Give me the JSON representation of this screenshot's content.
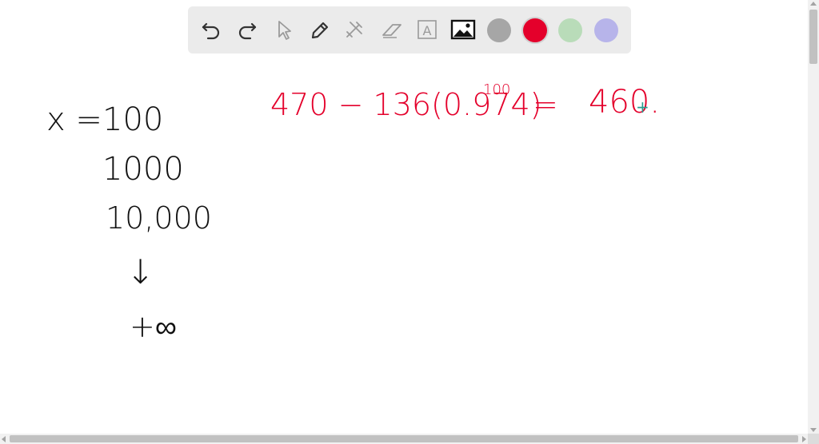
{
  "toolbar": {
    "tools": [
      {
        "name": "undo-icon"
      },
      {
        "name": "redo-icon"
      },
      {
        "name": "pointer-icon"
      },
      {
        "name": "pen-icon"
      },
      {
        "name": "tools-icon"
      },
      {
        "name": "eraser-icon"
      },
      {
        "name": "text-icon",
        "glyph": "A"
      },
      {
        "name": "image-icon"
      }
    ],
    "colors": [
      {
        "name": "gray",
        "hex": "#a6a6a6"
      },
      {
        "name": "red",
        "hex": "#e4002b"
      },
      {
        "name": "green",
        "hex": "#b9dcb9"
      },
      {
        "name": "purple",
        "hex": "#b7b4ea"
      }
    ],
    "selected_color": "red"
  },
  "board": {
    "x_label": "x =",
    "x_values": [
      "100",
      "1000",
      "10,000"
    ],
    "arrow": "↓",
    "limit": "+∞",
    "equation": {
      "lhs_main": "470 − 136(0.974)",
      "exponent": "100",
      "equals": "=",
      "result": "460."
    },
    "cursor": "+"
  }
}
